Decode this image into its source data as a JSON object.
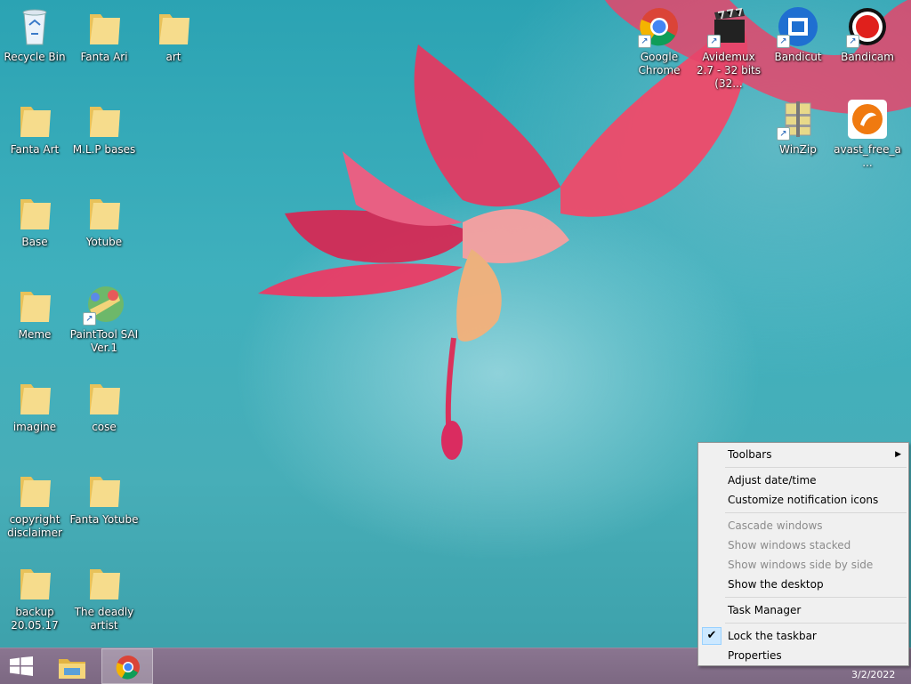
{
  "desktop": {
    "icons": [
      {
        "label": "Recycle Bin",
        "icon": "recycle-bin-icon"
      },
      {
        "label": "Fanta Ari",
        "icon": "folder-icon"
      },
      {
        "label": "art",
        "icon": "folder-icon"
      },
      {
        "label": "Fanta Art",
        "icon": "folder-icon"
      },
      {
        "label": "M.L.P bases",
        "icon": "folder-icon"
      },
      {
        "label": "Base",
        "icon": "folder-icon"
      },
      {
        "label": "Yotube",
        "icon": "folder-icon"
      },
      {
        "label": "Meme",
        "icon": "folder-icon"
      },
      {
        "label": "PaintTool SAI Ver.1",
        "icon": "painttool-sai-icon"
      },
      {
        "label": "imagine",
        "icon": "folder-icon"
      },
      {
        "label": "cose",
        "icon": "folder-icon"
      },
      {
        "label": "copyright disclaimer",
        "icon": "folder-icon"
      },
      {
        "label": "Fanta Yotube",
        "icon": "folder-icon"
      },
      {
        "label": "backup 20.05.17",
        "icon": "folder-icon"
      },
      {
        "label": "The deadly artist",
        "icon": "folder-icon"
      },
      {
        "label": "Google Chrome",
        "icon": "chrome-icon"
      },
      {
        "label": "Avidemux 2.7 - 32 bits (32...",
        "icon": "avidemux-icon"
      },
      {
        "label": "Bandicut",
        "icon": "bandicut-icon"
      },
      {
        "label": "Bandicam",
        "icon": "bandicam-icon"
      },
      {
        "label": "WinZip",
        "icon": "winzip-icon"
      },
      {
        "label": "avast_free_a...",
        "icon": "avast-icon"
      }
    ]
  },
  "context_menu": {
    "toolbars": "Toolbars",
    "adjust_datetime": "Adjust date/time",
    "customize_notification": "Customize notification icons",
    "cascade": "Cascade windows",
    "stacked": "Show windows stacked",
    "side_by_side": "Show windows side by side",
    "show_desktop": "Show the desktop",
    "task_manager": "Task Manager",
    "lock_taskbar": "Lock the taskbar",
    "properties": "Properties",
    "check_mark": "✔",
    "submenu_arrow": "▶"
  },
  "taskbar": {
    "date": "3/2/2022",
    "start_icon": "windows-logo-icon",
    "explorer_icon": "file-explorer-icon",
    "chrome_icon": "chrome-icon"
  },
  "colors": {
    "taskbar": "#7c6882",
    "menu_bg": "#f0f0f0",
    "checked_bg": "#cce8ff",
    "folder": "#f3d57f"
  }
}
